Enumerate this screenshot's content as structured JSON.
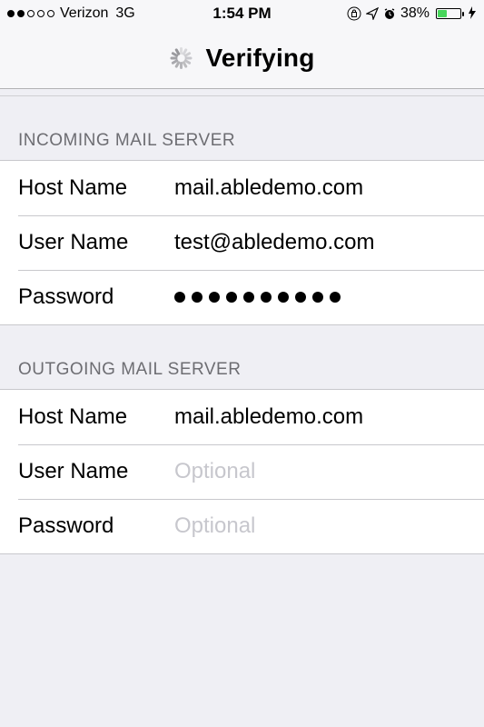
{
  "status": {
    "signal_filled": 2,
    "signal_total": 5,
    "carrier": "Verizon",
    "network": "3G",
    "time": "1:54 PM",
    "battery_pct": "38%",
    "battery_level": 38
  },
  "nav": {
    "title": "Verifying"
  },
  "sections": {
    "incoming": {
      "title": "INCOMING MAIL SERVER",
      "host_label": "Host Name",
      "host_value": "mail.abledemo.com",
      "user_label": "User Name",
      "user_value": "test@abledemo.com",
      "password_label": "Password",
      "password_dots": 10
    },
    "outgoing": {
      "title": "OUTGOING MAIL SERVER",
      "host_label": "Host Name",
      "host_value": "mail.abledemo.com",
      "user_label": "User Name",
      "user_placeholder": "Optional",
      "password_label": "Password",
      "password_placeholder": "Optional"
    }
  }
}
